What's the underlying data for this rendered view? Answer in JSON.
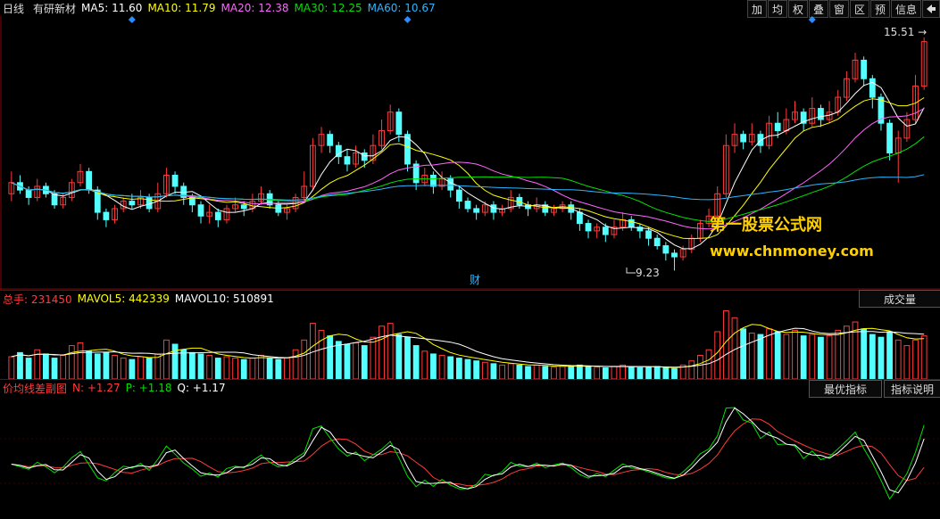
{
  "header": {
    "period": "日线",
    "stock_name": "有研新材",
    "ma5": "MA5: 11.60",
    "ma10": "MA10: 11.79",
    "ma20": "MA20: 12.38",
    "ma30": "MA30: 12.25",
    "ma60": "MA60: 10.67"
  },
  "toolbar": {
    "add": "加",
    "mean": "均",
    "rights": "权",
    "overlay": "叠",
    "window": "窗",
    "range": "区",
    "forecast": "预",
    "info": "信息",
    "arrow_icon": "back-arrow-icon"
  },
  "price_chart": {
    "high_label": "15.51",
    "low_label": "9.23",
    "finance_marker": "财"
  },
  "volume_panel": {
    "total": "总手: 231450",
    "mavol5": "MAVOL5: 442339",
    "mavol10": "MAVOL10: 510891",
    "button": "成交量"
  },
  "indicator_panel": {
    "name": "价均线差副图",
    "n": "N: +1.27",
    "p": "P: +1.18",
    "q": "Q: +1.17",
    "best_button": "最优指标",
    "help_button": "指标说明"
  },
  "watermark": {
    "line1": "第一股票公式网",
    "line2": "www.chnmoney.com"
  },
  "colors": {
    "up": "#ff3b3b",
    "down": "#54ffff",
    "ma5": "#ffffff",
    "ma10": "#ffff00",
    "ma20": "#ff66ff",
    "ma30": "#00e000",
    "ma60": "#2cb6ff",
    "diamond": "#2c8cff"
  },
  "chart_data": {
    "type": "candlestick",
    "price_range": [
      9.0,
      15.8
    ],
    "candles": [
      [
        11.3,
        11.6,
        11.9,
        11.1
      ],
      [
        11.6,
        11.4,
        11.8,
        11.3
      ],
      [
        11.4,
        11.2,
        11.5,
        11.0
      ],
      [
        11.2,
        11.5,
        11.7,
        11.1
      ],
      [
        11.5,
        11.3,
        11.6,
        11.2
      ],
      [
        11.3,
        11.0,
        11.4,
        10.9
      ],
      [
        11.0,
        11.2,
        11.3,
        10.9
      ],
      [
        11.2,
        11.6,
        11.7,
        11.1
      ],
      [
        11.6,
        11.9,
        12.1,
        11.5
      ],
      [
        11.9,
        11.4,
        12.0,
        11.3
      ],
      [
        11.4,
        10.8,
        11.5,
        10.6
      ],
      [
        10.8,
        10.6,
        10.9,
        10.4
      ],
      [
        10.6,
        10.9,
        11.0,
        10.5
      ],
      [
        10.9,
        11.1,
        11.2,
        10.8
      ],
      [
        11.1,
        11.0,
        11.3,
        10.9
      ],
      [
        11.0,
        11.2,
        11.4,
        10.9
      ],
      [
        11.2,
        10.9,
        11.3,
        10.8
      ],
      [
        10.9,
        11.3,
        11.6,
        10.8
      ],
      [
        11.3,
        11.8,
        12.0,
        11.2
      ],
      [
        11.8,
        11.5,
        11.9,
        11.3
      ],
      [
        11.5,
        11.2,
        11.6,
        11.0
      ],
      [
        11.2,
        11.0,
        11.3,
        10.8
      ],
      [
        11.0,
        10.7,
        11.1,
        10.5
      ],
      [
        10.7,
        10.8,
        11.0,
        10.5
      ],
      [
        10.8,
        10.6,
        10.9,
        10.4
      ],
      [
        10.6,
        10.9,
        11.0,
        10.5
      ],
      [
        10.9,
        11.0,
        11.2,
        10.8
      ],
      [
        11.0,
        10.9,
        11.1,
        10.7
      ],
      [
        10.9,
        11.1,
        11.3,
        10.8
      ],
      [
        11.1,
        11.3,
        11.5,
        11.0
      ],
      [
        11.3,
        11.0,
        11.4,
        10.9
      ],
      [
        11.0,
        10.8,
        11.1,
        10.7
      ],
      [
        10.8,
        10.9,
        11.0,
        10.6
      ],
      [
        10.9,
        11.2,
        11.3,
        10.8
      ],
      [
        11.2,
        11.5,
        11.9,
        11.1
      ],
      [
        11.5,
        12.6,
        12.8,
        11.4
      ],
      [
        12.6,
        12.9,
        13.1,
        12.4
      ],
      [
        12.9,
        12.6,
        13.0,
        12.4
      ],
      [
        12.6,
        12.3,
        12.7,
        12.1
      ],
      [
        12.3,
        12.1,
        12.5,
        11.9
      ],
      [
        12.1,
        12.4,
        12.6,
        12.0
      ],
      [
        12.4,
        12.2,
        12.5,
        12.0
      ],
      [
        12.2,
        12.6,
        12.9,
        12.1
      ],
      [
        12.6,
        13.0,
        13.3,
        12.5
      ],
      [
        13.0,
        13.5,
        13.7,
        12.9
      ],
      [
        13.5,
        12.9,
        13.6,
        12.7
      ],
      [
        12.9,
        12.1,
        13.0,
        11.9
      ],
      [
        12.1,
        11.6,
        12.2,
        11.4
      ],
      [
        11.6,
        11.8,
        12.0,
        11.5
      ],
      [
        11.8,
        11.5,
        11.9,
        11.3
      ],
      [
        11.5,
        11.7,
        11.9,
        11.4
      ],
      [
        11.7,
        11.4,
        11.8,
        11.2
      ],
      [
        11.4,
        11.1,
        11.5,
        10.9
      ],
      [
        11.1,
        10.9,
        11.2,
        10.8
      ],
      [
        10.9,
        10.8,
        11.0,
        10.6
      ],
      [
        10.8,
        11.0,
        11.1,
        10.7
      ],
      [
        11.0,
        10.8,
        11.1,
        10.6
      ],
      [
        10.8,
        10.9,
        11.0,
        10.7
      ],
      [
        10.9,
        11.2,
        11.4,
        10.8
      ],
      [
        11.2,
        11.0,
        11.3,
        10.9
      ],
      [
        11.0,
        10.9,
        11.1,
        10.7
      ],
      [
        10.9,
        11.0,
        11.2,
        10.8
      ],
      [
        11.0,
        10.8,
        11.1,
        10.7
      ],
      [
        10.8,
        10.9,
        11.0,
        10.7
      ],
      [
        10.9,
        11.0,
        11.1,
        10.8
      ],
      [
        11.0,
        10.8,
        11.1,
        10.6
      ],
      [
        10.8,
        10.5,
        10.9,
        10.3
      ],
      [
        10.5,
        10.3,
        10.6,
        10.1
      ],
      [
        10.3,
        10.4,
        10.5,
        10.1
      ],
      [
        10.4,
        10.2,
        10.5,
        10.0
      ],
      [
        10.2,
        10.4,
        10.6,
        10.1
      ],
      [
        10.4,
        10.6,
        10.8,
        10.3
      ],
      [
        10.6,
        10.4,
        10.7,
        10.3
      ],
      [
        10.4,
        10.3,
        10.5,
        10.1
      ],
      [
        10.3,
        10.1,
        10.4,
        9.9
      ],
      [
        10.1,
        9.9,
        10.2,
        9.8
      ],
      [
        9.9,
        9.7,
        10.0,
        9.5
      ],
      [
        9.7,
        9.6,
        9.8,
        9.23
      ],
      [
        9.6,
        9.8,
        9.9,
        9.5
      ],
      [
        9.8,
        10.1,
        10.2,
        9.7
      ],
      [
        10.1,
        10.5,
        10.6,
        10.0
      ],
      [
        10.5,
        10.7,
        10.9,
        10.4
      ],
      [
        10.7,
        11.3,
        11.5,
        10.6
      ],
      [
        11.3,
        12.6,
        12.9,
        11.2
      ],
      [
        12.6,
        12.9,
        13.2,
        12.4
      ],
      [
        12.9,
        12.7,
        13.0,
        12.5
      ],
      [
        12.7,
        12.9,
        13.2,
        12.6
      ],
      [
        12.9,
        12.6,
        13.0,
        12.4
      ],
      [
        12.6,
        13.2,
        13.4,
        12.5
      ],
      [
        13.2,
        13.0,
        13.5,
        12.8
      ],
      [
        13.0,
        13.3,
        13.6,
        12.9
      ],
      [
        13.3,
        13.5,
        13.8,
        13.2
      ],
      [
        13.5,
        13.2,
        13.6,
        13.0
      ],
      [
        13.2,
        13.6,
        13.9,
        13.1
      ],
      [
        13.6,
        13.3,
        13.7,
        13.1
      ],
      [
        13.3,
        13.5,
        13.8,
        13.2
      ],
      [
        13.5,
        13.9,
        14.1,
        13.4
      ],
      [
        13.9,
        14.4,
        14.6,
        13.8
      ],
      [
        14.4,
        14.9,
        15.1,
        14.3
      ],
      [
        14.9,
        14.4,
        15.0,
        14.2
      ],
      [
        14.4,
        13.9,
        14.5,
        13.6
      ],
      [
        13.9,
        13.2,
        14.0,
        13.0
      ],
      [
        13.2,
        12.4,
        13.3,
        12.2
      ],
      [
        12.4,
        12.8,
        13.0,
        11.6
      ],
      [
        12.8,
        13.3,
        13.5,
        12.7
      ],
      [
        13.3,
        14.2,
        14.5,
        13.2
      ],
      [
        14.2,
        15.4,
        15.51,
        14.1
      ]
    ],
    "volumes": [
      [
        320,
        1
      ],
      [
        380,
        0
      ],
      [
        300,
        0
      ],
      [
        420,
        1
      ],
      [
        360,
        0
      ],
      [
        300,
        0
      ],
      [
        340,
        1
      ],
      [
        480,
        1
      ],
      [
        520,
        1
      ],
      [
        400,
        0
      ],
      [
        360,
        0
      ],
      [
        380,
        0
      ],
      [
        340,
        1
      ],
      [
        300,
        1
      ],
      [
        280,
        0
      ],
      [
        320,
        1
      ],
      [
        300,
        0
      ],
      [
        360,
        1
      ],
      [
        560,
        1
      ],
      [
        500,
        0
      ],
      [
        420,
        0
      ],
      [
        380,
        0
      ],
      [
        360,
        0
      ],
      [
        340,
        1
      ],
      [
        300,
        0
      ],
      [
        320,
        1
      ],
      [
        300,
        1
      ],
      [
        280,
        0
      ],
      [
        300,
        1
      ],
      [
        340,
        1
      ],
      [
        300,
        0
      ],
      [
        280,
        0
      ],
      [
        300,
        1
      ],
      [
        420,
        1
      ],
      [
        560,
        1
      ],
      [
        800,
        1
      ],
      [
        700,
        1
      ],
      [
        620,
        0
      ],
      [
        540,
        0
      ],
      [
        500,
        0
      ],
      [
        520,
        1
      ],
      [
        480,
        0
      ],
      [
        600,
        1
      ],
      [
        760,
        1
      ],
      [
        800,
        1
      ],
      [
        640,
        0
      ],
      [
        600,
        0
      ],
      [
        480,
        0
      ],
      [
        400,
        1
      ],
      [
        360,
        0
      ],
      [
        340,
        1
      ],
      [
        320,
        0
      ],
      [
        300,
        0
      ],
      [
        280,
        0
      ],
      [
        260,
        0
      ],
      [
        240,
        1
      ],
      [
        220,
        0
      ],
      [
        200,
        1
      ],
      [
        220,
        1
      ],
      [
        200,
        0
      ],
      [
        180,
        0
      ],
      [
        200,
        1
      ],
      [
        180,
        0
      ],
      [
        170,
        1
      ],
      [
        180,
        1
      ],
      [
        190,
        0
      ],
      [
        200,
        0
      ],
      [
        180,
        0
      ],
      [
        170,
        1
      ],
      [
        160,
        0
      ],
      [
        180,
        1
      ],
      [
        200,
        1
      ],
      [
        170,
        0
      ],
      [
        160,
        0
      ],
      [
        170,
        0
      ],
      [
        180,
        0
      ],
      [
        160,
        0
      ],
      [
        150,
        0
      ],
      [
        200,
        1
      ],
      [
        260,
        1
      ],
      [
        340,
        1
      ],
      [
        420,
        1
      ],
      [
        680,
        1
      ],
      [
        980,
        1
      ],
      [
        880,
        1
      ],
      [
        720,
        0
      ],
      [
        660,
        1
      ],
      [
        640,
        0
      ],
      [
        720,
        1
      ],
      [
        680,
        0
      ],
      [
        640,
        1
      ],
      [
        700,
        1
      ],
      [
        620,
        0
      ],
      [
        640,
        1
      ],
      [
        600,
        0
      ],
      [
        620,
        1
      ],
      [
        700,
        1
      ],
      [
        760,
        1
      ],
      [
        820,
        1
      ],
      [
        720,
        0
      ],
      [
        640,
        0
      ],
      [
        600,
        0
      ],
      [
        680,
        0
      ],
      [
        560,
        1
      ],
      [
        480,
        1
      ],
      [
        560,
        1
      ],
      [
        620,
        1
      ]
    ],
    "indicator": {
      "series": [
        "N",
        "P",
        "Q"
      ]
    }
  }
}
